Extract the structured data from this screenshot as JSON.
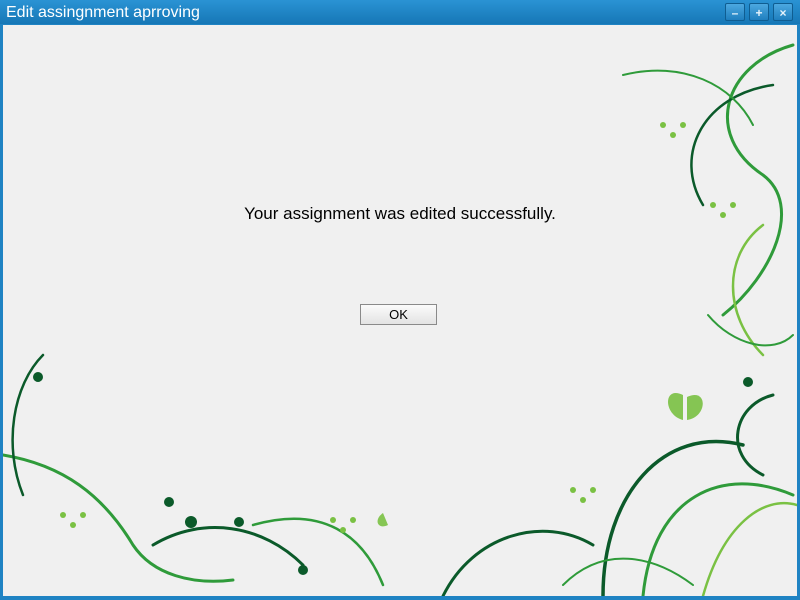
{
  "window": {
    "title": "Edit assingnment aprroving",
    "controls": {
      "minimize_icon": "minimize-icon",
      "maximize_icon": "maximize-icon",
      "close_icon": "close-icon"
    }
  },
  "dialog": {
    "message": "Your assignment was edited successfully.",
    "ok_label": "OK"
  },
  "colors": {
    "titlebar": "#1f83c3",
    "background": "#f0f0f0",
    "floral_dark": "#0b5a2a",
    "floral_mid": "#2f9b3a",
    "floral_light": "#7ac143"
  }
}
